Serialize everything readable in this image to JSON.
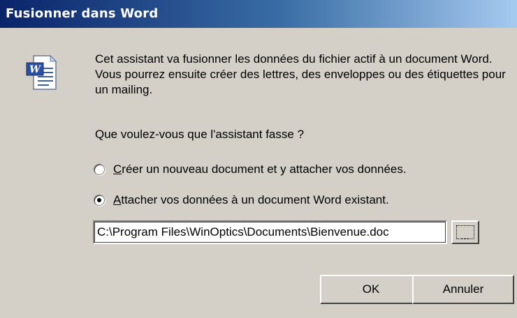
{
  "window": {
    "title": "Fusionner dans Word"
  },
  "icon": "word-document-icon",
  "intro_text": "Cet assistant va fusionner les données du fichier actif à un document Word. Vous pourrez ensuite créer des lettres, des enveloppes ou des étiquettes pour un mailing.",
  "question": "Que voulez-vous que l'assistant fasse ?",
  "options": [
    {
      "mnemonic": "C",
      "label_rest": "réer un nouveau document et y attacher vos données.",
      "selected": false
    },
    {
      "mnemonic": "A",
      "label_rest": "ttacher vos données à un document Word existant.",
      "selected": true
    }
  ],
  "path_field": {
    "value": "C:\\Program Files\\WinOptics\\Documents\\Bienvenue.doc"
  },
  "browse_button": {
    "label": "..."
  },
  "buttons": {
    "ok": "OK",
    "cancel": "Annuler"
  },
  "colors": {
    "dialog_bg": "#d4d0c8",
    "titlebar_start": "#0a246a",
    "titlebar_end": "#a6caf0",
    "title_text": "#ffffff"
  }
}
